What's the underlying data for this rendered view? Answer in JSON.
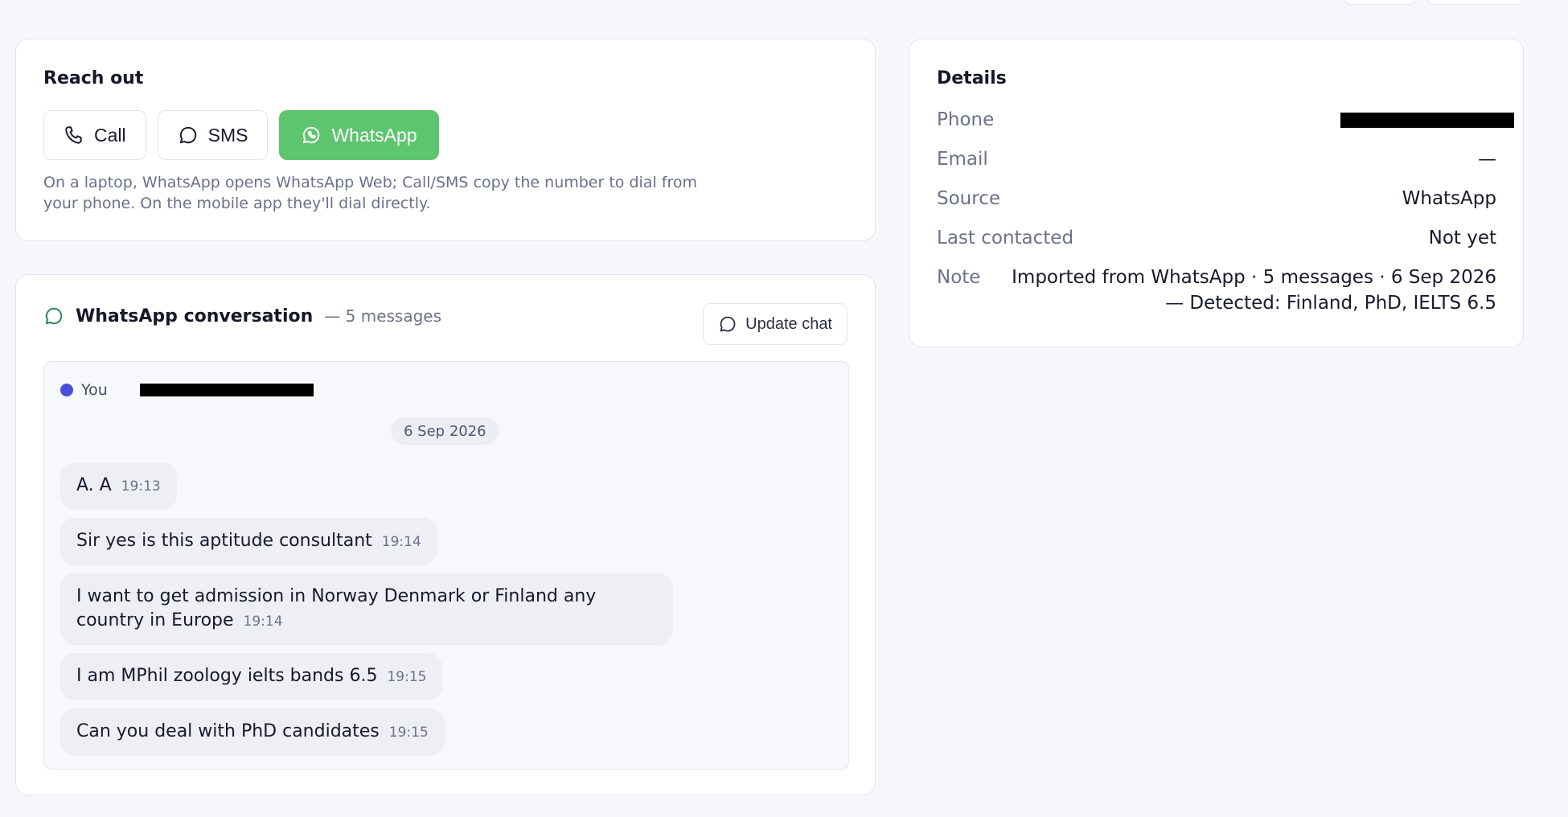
{
  "reach_out": {
    "title": "Reach out",
    "buttons": [
      {
        "label": "Call",
        "icon": "phone-icon"
      },
      {
        "label": "SMS",
        "icon": "chat-bubble-icon"
      },
      {
        "label": "WhatsApp",
        "icon": "whatsapp-icon"
      }
    ],
    "hint": "On a laptop, WhatsApp opens WhatsApp Web; Call/SMS copy the number to dial from your phone. On the mobile app they'll dial directly."
  },
  "conversation": {
    "title": "WhatsApp conversation",
    "count": "— 5 messages",
    "update_label": "Update chat",
    "you_label": "You",
    "date": "6 Sep 2026",
    "messages": [
      {
        "text": "A. A",
        "time": "19:13"
      },
      {
        "text": "Sir yes is this aptitude consultant",
        "time": "19:14"
      },
      {
        "text": "I want to get admission in Norway Denmark or Finland any country in Europe",
        "time": "19:14"
      },
      {
        "text": "I am MPhil zoology ielts bands 6.5",
        "time": "19:15"
      },
      {
        "text": "Can you deal with PhD candidates",
        "time": "19:15"
      }
    ]
  },
  "details": {
    "title": "Details",
    "phone_label": "Phone",
    "email_label": "Email",
    "email_value": "—",
    "source_label": "Source",
    "source_value": "WhatsApp",
    "last_contacted_label": "Last contacted",
    "last_contacted_value": "Not yet",
    "note_label": "Note",
    "note_value": "Imported from WhatsApp · 5 messages · 6 Sep 2026 — Detected: Finland, PhD, IELTS 6.5"
  },
  "colors": {
    "whatsapp_green": "#5ec56f",
    "you_dot": "#4651d8",
    "accent_icon": "#2f8f5b"
  }
}
